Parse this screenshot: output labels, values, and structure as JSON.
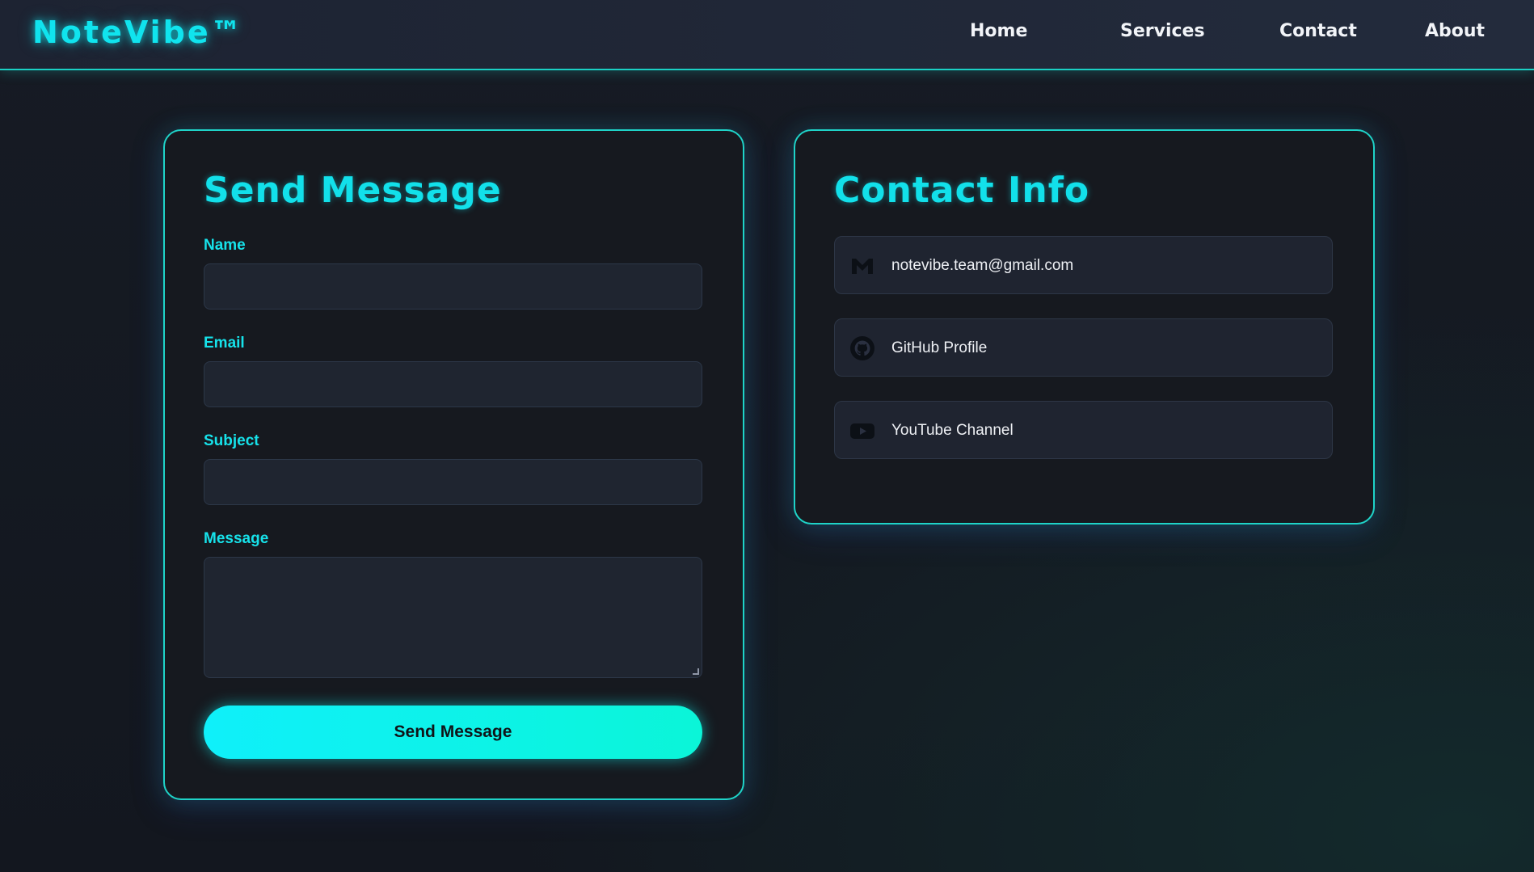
{
  "brand": "NoteVibe™",
  "nav": [
    "Home",
    "Services",
    "Contact",
    "About"
  ],
  "form": {
    "title": "Send Message",
    "fields": [
      {
        "label": "Name",
        "value": ""
      },
      {
        "label": "Email",
        "value": ""
      },
      {
        "label": "Subject",
        "value": ""
      },
      {
        "label": "Message",
        "value": ""
      }
    ],
    "submit_label": "Send Message"
  },
  "contact": {
    "title": "Contact Info",
    "items": [
      {
        "icon": "gmail-icon",
        "text": "notevibe.team@gmail.com"
      },
      {
        "icon": "github-icon",
        "text": "GitHub Profile"
      },
      {
        "icon": "youtube-icon",
        "text": "YouTube Channel"
      }
    ]
  },
  "colors": {
    "accent": "#12e0ea",
    "card_border": "#1fd3c8",
    "button_start": "#0ff0fa",
    "button_end": "#0bf5d8",
    "background": "#141820",
    "card_background": "#16191f",
    "field_background": "#1f2530"
  }
}
